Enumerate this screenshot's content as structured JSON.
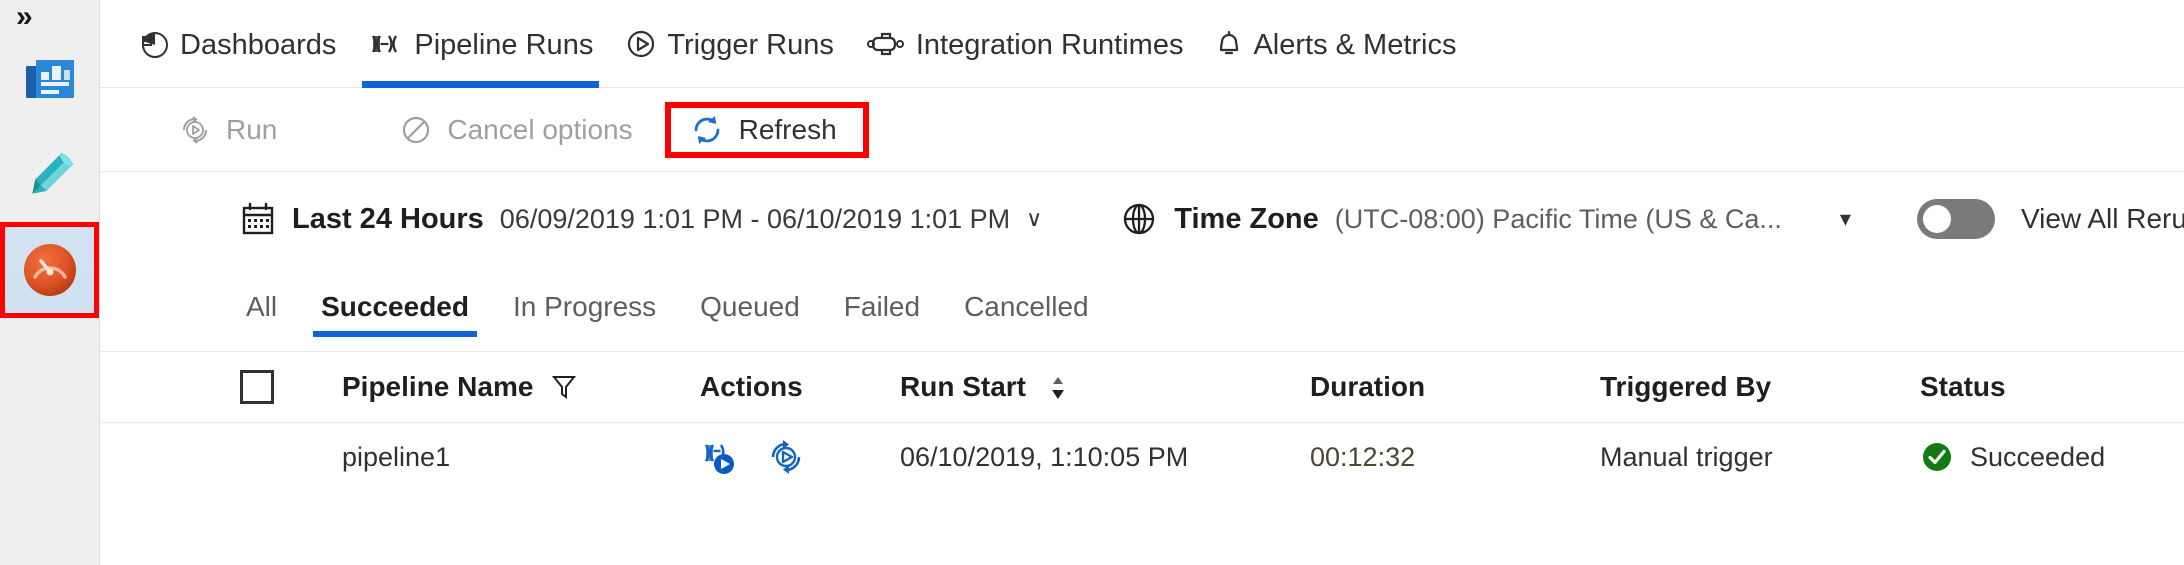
{
  "rail": {
    "expand_glyph": "»",
    "items": [
      {
        "id": "overview",
        "name": "overview-icon",
        "title": "Overview",
        "selected": false
      },
      {
        "id": "author",
        "name": "pencil-icon",
        "title": "Author",
        "selected": false
      },
      {
        "id": "monitor",
        "name": "gauge-icon",
        "title": "Monitor",
        "selected": true
      }
    ]
  },
  "topnav": {
    "tabs": [
      {
        "label": "Dashboards",
        "icon": "pie-chart-icon",
        "active": false
      },
      {
        "label": "Pipeline Runs",
        "icon": "pipeline-runs-icon",
        "active": true
      },
      {
        "label": "Trigger Runs",
        "icon": "play-circle-icon",
        "active": false
      },
      {
        "label": "Integration Runtimes",
        "icon": "integration-runtime-icon",
        "active": false
      },
      {
        "label": "Alerts & Metrics",
        "icon": "bell-icon",
        "active": false
      }
    ],
    "active_underline_color": "#0f62d7"
  },
  "commandbar": {
    "run_label": "Run",
    "cancel_label": "Cancel options",
    "refresh_label": "Refresh",
    "highlight_color": "#ff0000",
    "refresh_icon_color": "#1f6fd0"
  },
  "filterbar": {
    "range_label": "Last 24 Hours",
    "range_value": "06/09/2019 1:01 PM - 06/10/2019 1:01 PM",
    "range_caret": "∨",
    "timezone_label": "Time Zone",
    "timezone_value": "(UTC-08:00) Pacific Time (US & Ca...",
    "timezone_caret": "▾",
    "toggle_state": "off",
    "toggle_label": "View All Reru"
  },
  "statustabs": {
    "tabs": [
      {
        "label": "All",
        "active": false
      },
      {
        "label": "Succeeded",
        "active": true
      },
      {
        "label": "In Progress",
        "active": false
      },
      {
        "label": "Queued",
        "active": false
      },
      {
        "label": "Failed",
        "active": false
      },
      {
        "label": "Cancelled",
        "active": false
      }
    ]
  },
  "table": {
    "columns": {
      "select": "",
      "pipeline_name": "Pipeline Name",
      "actions": "Actions",
      "run_start": "Run Start",
      "duration": "Duration",
      "triggered_by": "Triggered By",
      "status": "Status"
    },
    "pipeline_name_icon": "filter-icon",
    "run_start_sort_icon": "sort-descending-icon",
    "rows": [
      {
        "pipeline_name": "pipeline1",
        "actions": [
          "view-activity-runs-icon",
          "rerun-icon"
        ],
        "run_start": "06/10/2019, 1:10:05 PM",
        "duration": "00:12:32",
        "triggered_by": "Manual trigger",
        "status": "Succeeded",
        "status_icon": "check-circle-filled-icon",
        "status_color": "#0f7c23"
      }
    ]
  }
}
